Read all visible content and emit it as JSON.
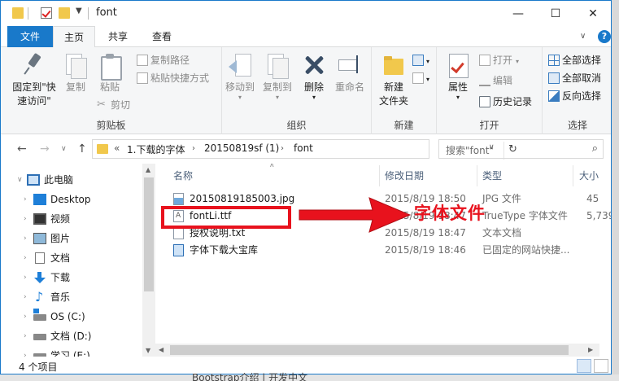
{
  "window": {
    "title": "font",
    "controls": {
      "minimize": "—",
      "maximize": "☐",
      "close": "✕"
    }
  },
  "ribbon_tabs": {
    "file": "文件",
    "home": "主页",
    "share": "共享",
    "view": "查看"
  },
  "ribbon": {
    "clipboard": {
      "label": "剪贴板",
      "pin_line1": "固定到\"快",
      "pin_line2": "速访问\"",
      "copy": "复制",
      "paste": "粘贴",
      "copy_path": "复制路径",
      "paste_shortcut": "粘贴快捷方式",
      "cut": "剪切"
    },
    "organize": {
      "label": "组织",
      "move_to": "移动到",
      "copy_to": "复制到",
      "delete": "删除",
      "rename": "重命名"
    },
    "new": {
      "label": "新建",
      "new_folder_line1": "新建",
      "new_folder_line2": "文件夹"
    },
    "open": {
      "label": "打开",
      "properties": "属性",
      "open": "打开",
      "edit": "编辑",
      "history": "历史记录"
    },
    "select": {
      "label": "选择",
      "select_all": "全部选择",
      "select_none": "全部取消",
      "invert": "反向选择"
    }
  },
  "address": {
    "overflow": "«",
    "crumbs": [
      "1.下载的字体",
      "20150819sf (1)",
      "font"
    ],
    "search_placeholder": "搜索\"font\""
  },
  "nav_pane": {
    "items": [
      {
        "label": "此电脑",
        "icon": "computer-icon"
      },
      {
        "label": "Desktop",
        "icon": "desktop-icon"
      },
      {
        "label": "视频",
        "icon": "video-icon"
      },
      {
        "label": "图片",
        "icon": "pictures-icon"
      },
      {
        "label": "文档",
        "icon": "documents-icon"
      },
      {
        "label": "下载",
        "icon": "download-icon"
      },
      {
        "label": "音乐",
        "icon": "music-icon"
      },
      {
        "label": "OS (C:)",
        "icon": "drive-icon"
      },
      {
        "label": "文档 (D:)",
        "icon": "drive-icon"
      },
      {
        "label": "学习 (E:)",
        "icon": "drive-icon"
      }
    ]
  },
  "file_list": {
    "columns": {
      "name": "名称",
      "date": "修改日期",
      "type": "类型",
      "size": "大小"
    },
    "rows": [
      {
        "name": "20150819185003.jpg",
        "date": "2015/8/19 18:50",
        "type": "JPG 文件",
        "size": "45"
      },
      {
        "name": "fontLi.ttf",
        "date": "2015/8/19 18:47",
        "type": "TrueType 字体文件",
        "size": "5,739"
      },
      {
        "name": "授权说明.txt",
        "date": "2015/8/19 18:47",
        "type": "文本文档",
        "size": ""
      },
      {
        "name": "字体下载大宝库",
        "date": "2015/8/19 18:46",
        "type": "已固定的网站快捷...",
        "size": ""
      }
    ]
  },
  "status": {
    "item_count": "4 个项目"
  },
  "annotation": {
    "text": "字体文件",
    "color": "#e8121d"
  },
  "background_text": "Bootstrap介绍 | 开发中文",
  "colors": {
    "accent": "#1979ca",
    "ribbon_bg": "#f5f6f7",
    "folder": "#f1c84c"
  }
}
